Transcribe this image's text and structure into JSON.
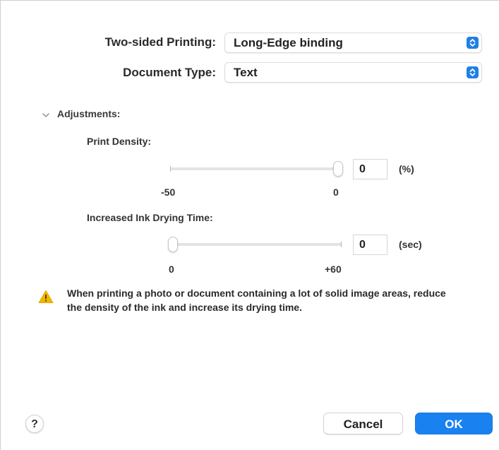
{
  "settings": {
    "two_sided_label": "Two-sided Printing:",
    "two_sided_value": "Long-Edge binding",
    "document_type_label": "Document Type:",
    "document_type_value": "Text"
  },
  "adjustments": {
    "title": "Adjustments:",
    "expanded": true,
    "print_density": {
      "label": "Print Density:",
      "min_label": "-50",
      "max_label": "0",
      "min": -50,
      "max": 0,
      "value": 0,
      "value_text": "0",
      "unit": "(%)"
    },
    "ink_drying_time": {
      "label": "Increased Ink Drying Time:",
      "min_label": "0",
      "max_label": "+60",
      "min": 0,
      "max": 60,
      "value": 0,
      "value_text": "0",
      "unit": "(sec)"
    }
  },
  "warning": {
    "icon": "warning-triangle-icon",
    "text": "When printing a photo or document containing a lot of solid image areas, reduce the density of the ink and increase its drying time."
  },
  "footer": {
    "help_label": "?",
    "cancel_label": "Cancel",
    "ok_label": "OK"
  },
  "colors": {
    "accent": "#1a82f0",
    "warning": "#f2b600"
  }
}
